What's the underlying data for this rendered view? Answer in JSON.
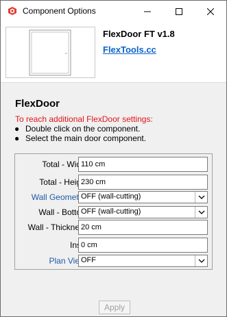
{
  "window": {
    "title": "Component Options"
  },
  "header": {
    "product_name": "FlexDoor FT v1.8",
    "link_text": "FlexTools.cc"
  },
  "main": {
    "section_title": "FlexDoor",
    "instructions_heading": "To reach additional FlexDoor settings:",
    "instructions": [
      "Double click on the component.",
      "Select the main door component."
    ]
  },
  "form": {
    "total_width": {
      "label": "Total - Width",
      "value": "110 cm"
    },
    "total_height": {
      "label": "Total - Height",
      "value": "230 cm"
    },
    "wall_geometry": {
      "label": "Wall Geometry:",
      "value": "OFF (wall-cutting)"
    },
    "wall_bottom": {
      "label": "Wall - Bottom",
      "value": "OFF (wall-cutting)"
    },
    "wall_thickness": {
      "label": "Wall - Thickness",
      "value": "20 cm"
    },
    "inset": {
      "label": "Inset",
      "value": "0 cm"
    },
    "plan_view": {
      "label": "Plan View:",
      "value": "OFF"
    }
  },
  "footer": {
    "apply_label": "Apply"
  },
  "icons": {
    "app": "sketchup-icon",
    "minimize": "minimize-icon",
    "maximize": "maximize-icon",
    "close": "close-icon",
    "dropdown": "chevron-down-icon"
  },
  "colors": {
    "link": "#0b63c9",
    "instructions": "#e2131a",
    "field_link_label": "#1c5aa8"
  }
}
